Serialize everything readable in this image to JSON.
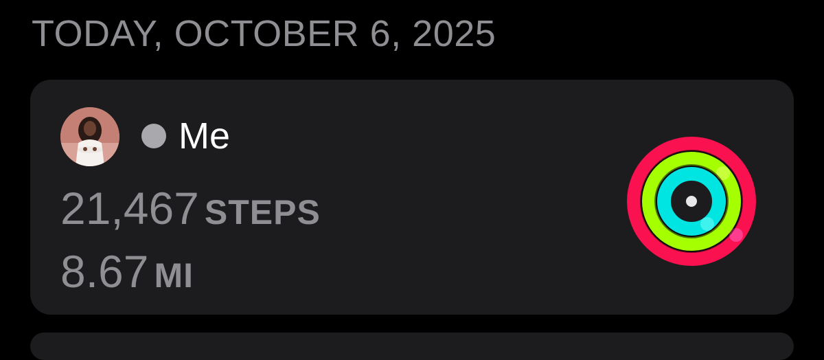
{
  "date_header": "TODAY, OCTOBER 6, 2025",
  "card": {
    "name": "Me",
    "steps": {
      "value": "21,467",
      "unit": "STEPS"
    },
    "distance": {
      "value": "8.67",
      "unit": "MI"
    },
    "status_dot_color": "#a8a8ad",
    "activity_rings": {
      "move": {
        "color": "#fa114f",
        "progress": 1.02
      },
      "exercise": {
        "color": "#a6ff00",
        "progress": 1.0
      },
      "stand": {
        "color": "#00e5e1",
        "progress": 1.0
      }
    }
  },
  "icons": {
    "avatar": "profile-photo",
    "status": "status-dot",
    "rings": "activity-rings-icon"
  }
}
